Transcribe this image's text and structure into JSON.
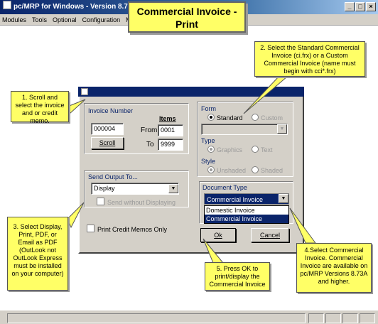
{
  "window": {
    "title": "pc/MRP for Windows - Version 8.738",
    "min_label": "_",
    "max_label": "□",
    "close_label": "×"
  },
  "menu": [
    "Modules",
    "Tools",
    "Optional",
    "Configuration",
    "M"
  ],
  "title_callout": {
    "line1": "Commercial Invoice -",
    "line2": "Print"
  },
  "dialog": {
    "invoice_group_label": "Invoice Number",
    "invoice_number": "000004",
    "items_label": "Items",
    "from_label": "From",
    "from_value": "0001",
    "to_label": "To",
    "to_value": "9999",
    "scroll_button": "Scroll",
    "send_output_label": "Send Output To...",
    "send_output_value": "Display",
    "send_without_displaying": "Send without Displaying",
    "print_credit_memos": "Print Credit Memos Only",
    "form_label": "Form",
    "form_standard": "Standard",
    "form_custom": "Custom",
    "type_label": "Type",
    "type_graphics": "Graphics",
    "type_text": "Text",
    "style_label": "Style",
    "style_unshaded": "Unshaded",
    "style_shaded": "Shaded",
    "doc_type_label": "Document Type",
    "doc_type_value": "Commercial Invoice",
    "doc_type_options": [
      "Domestic Invoice",
      "Commercial Invoice"
    ],
    "ok_button": "Ok",
    "cancel_button": "Cancel"
  },
  "callouts": {
    "c1": "1. Scroll and select the invoice and or credit memo.",
    "c2": "2. Select the Standard Commercial Invoice (ci.frx) or a Custom Commercial Invoice (name must begin with cci*.frx)",
    "c3": "3. Select Display, Print, PDF, or Email as PDF (OutLook not OutLook Express must be installed on your computer)",
    "c4": "4.Select Commercial Invoice. Commercial Invoice are available on pc/MRP Versions 8.73A and higher.",
    "c5": "5. Press OK to print/display the Commercial Invoice"
  },
  "colors": {
    "callout": "#ffff66",
    "dialog": "#d4d0c8",
    "titlebar": "#0a246a",
    "selection": "#0a246a"
  }
}
